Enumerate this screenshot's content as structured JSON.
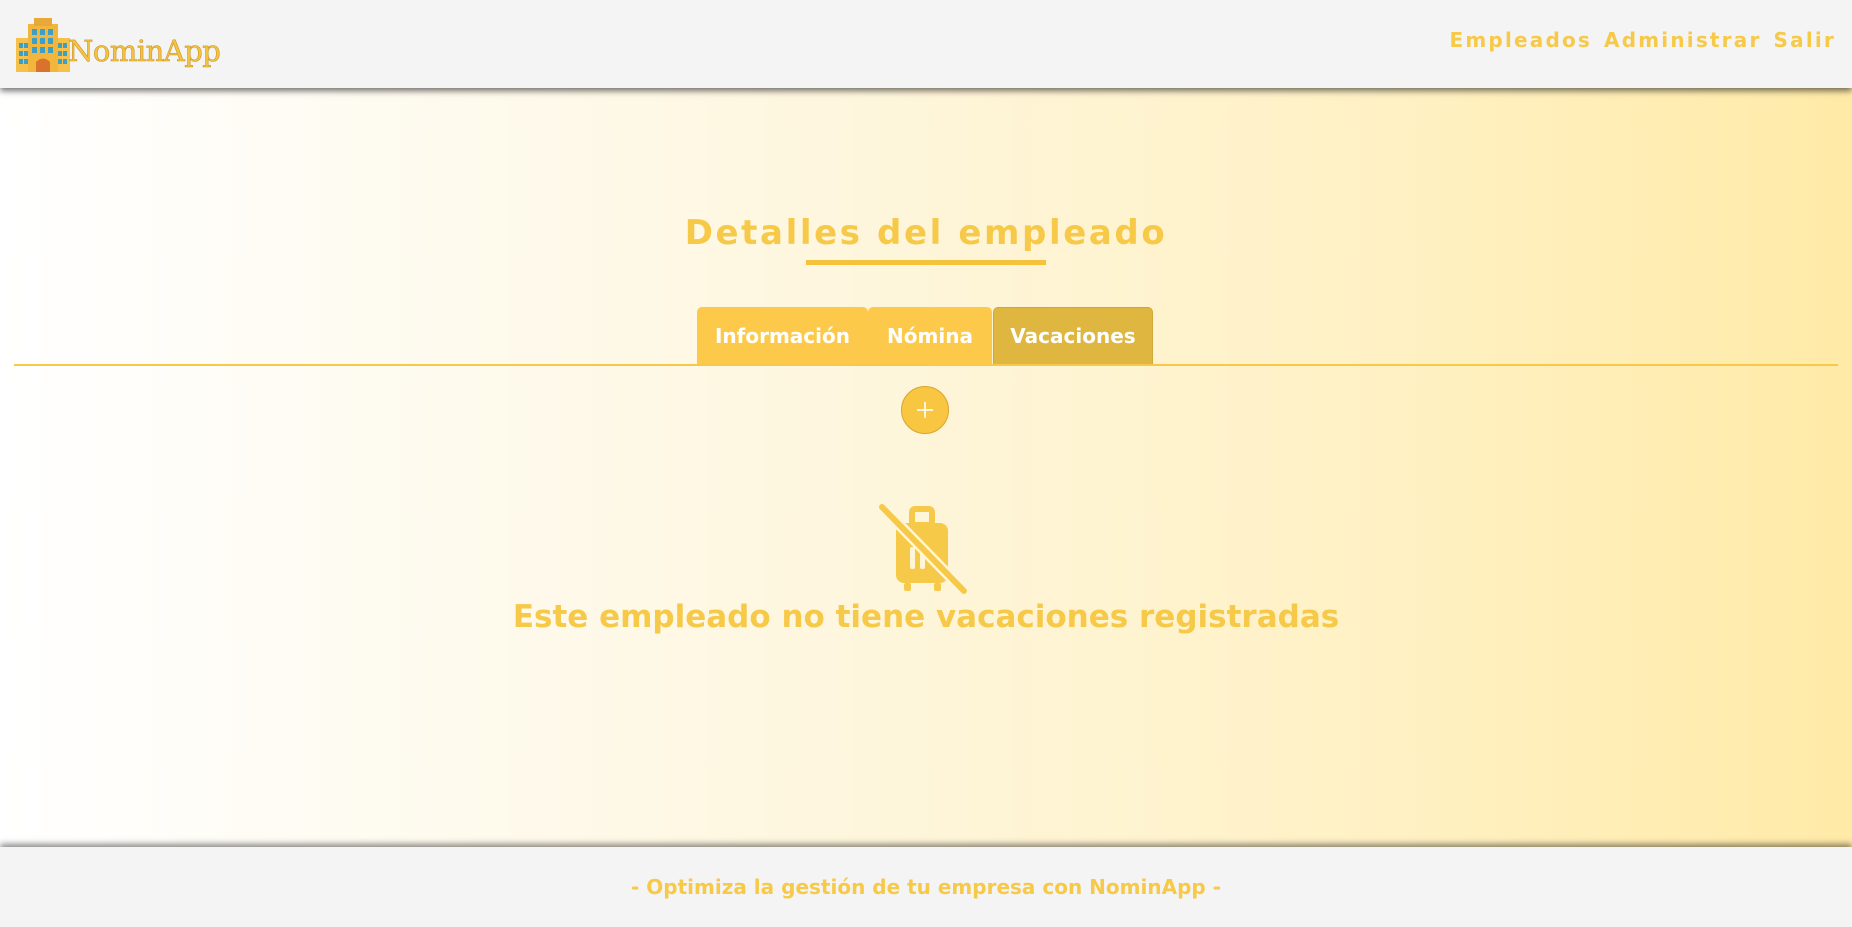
{
  "header": {
    "logo_text": "NominApp",
    "logo_icon": "building-icon",
    "nav": [
      {
        "label": "Empleados"
      },
      {
        "label": "Administrar"
      },
      {
        "label": "Salir"
      }
    ]
  },
  "main": {
    "title": "Detalles del empleado",
    "tabs": [
      {
        "label": "Información",
        "active": false
      },
      {
        "label": "Nómina",
        "active": false
      },
      {
        "label": "Vacaciones",
        "active": true
      }
    ],
    "add_icon": "plus-icon",
    "empty_icon": "no-luggage-icon",
    "empty_message": "Este empleado no tiene vacaciones registradas"
  },
  "footer": {
    "text": "- Optimiza la gestión de tu empresa con NominApp -"
  },
  "colors": {
    "accent": "#f7c948",
    "active_tab": "#dfb640",
    "header_bg": "#f4f4f4",
    "gradient_end": "#ffeaa7"
  }
}
